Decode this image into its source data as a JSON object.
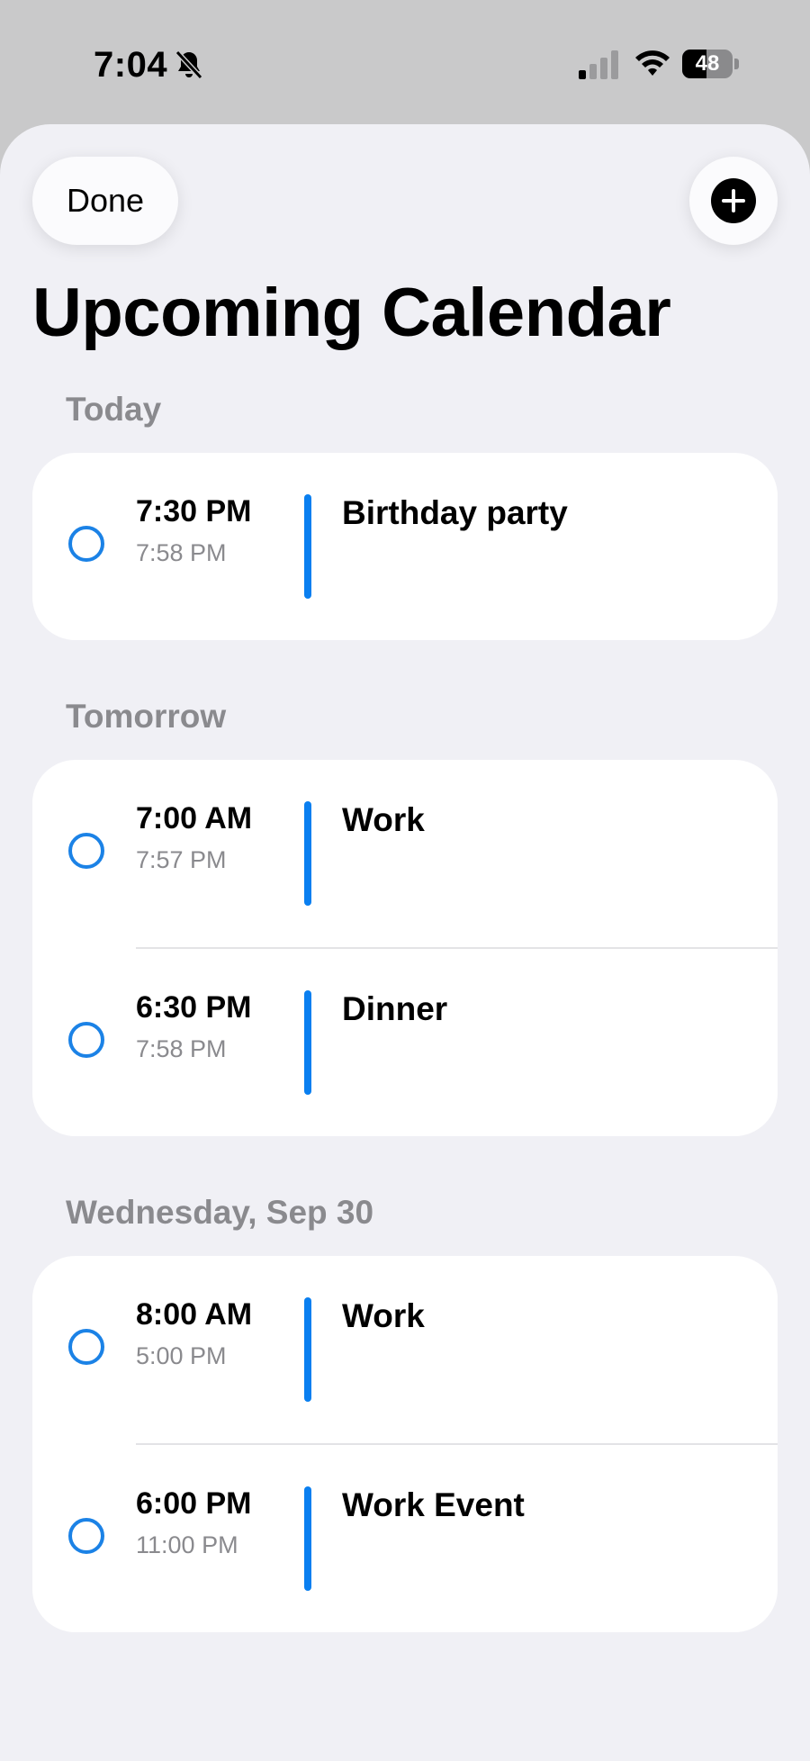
{
  "status_bar": {
    "time": "7:04",
    "battery_level": "48",
    "battery_fraction": 0.48,
    "icons": [
      "bell-slash-icon",
      "cellular-signal-icon",
      "wifi-icon",
      "battery-icon"
    ]
  },
  "header": {
    "done_label": "Done",
    "add_icon": "plus-circle-icon",
    "title": "Upcoming Calendar"
  },
  "colors": {
    "accent": "#0a7ff0",
    "circle": "#1b82e6",
    "background": "#f0f0f5",
    "secondary_text": "#8a8a8e"
  },
  "sections": [
    {
      "header": "Today",
      "events": [
        {
          "start": "7:30 PM",
          "end": "7:58 PM",
          "title": "Birthday party"
        }
      ]
    },
    {
      "header": "Tomorrow",
      "events": [
        {
          "start": "7:00 AM",
          "end": "7:57 PM",
          "title": "Work"
        },
        {
          "start": "6:30 PM",
          "end": "7:58 PM",
          "title": "Dinner"
        }
      ]
    },
    {
      "header": "Wednesday, Sep 30",
      "events": [
        {
          "start": "8:00 AM",
          "end": "5:00 PM",
          "title": "Work"
        },
        {
          "start": "6:00 PM",
          "end": "11:00 PM",
          "title": "Work Event"
        }
      ]
    }
  ]
}
